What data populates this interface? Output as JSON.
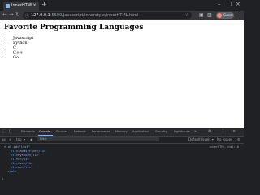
{
  "browser": {
    "tab_title": "InnerHTML",
    "address_host": "127.0.0.1",
    "address_path": ":5500/Javascript/innerstyle/innerHTML.html",
    "profile_label": "Guest"
  },
  "page": {
    "heading": "Favorite Programming Languages",
    "languages": [
      "Javascript",
      "Python",
      "C",
      "C++",
      "Go"
    ]
  },
  "devtools": {
    "tabs": [
      "Elements",
      "Console",
      "Sources",
      "Network",
      "Performance",
      "Memory",
      "Application",
      "Security",
      "Lighthouse"
    ],
    "active_tab": "Console",
    "context": "top",
    "filter_placeholder": "Filter",
    "levels": "Default levels ▾",
    "issues": "No Issues",
    "console_lines": [
      "▾ ul id=\"list\"",
      "<li>Javascript</li>",
      "<li>Python</li>",
      "<li>C</li>",
      "<li>C++</li>",
      "<li>Go</li>",
      "</ul>"
    ],
    "console_source": "innerHTML.html:16"
  }
}
